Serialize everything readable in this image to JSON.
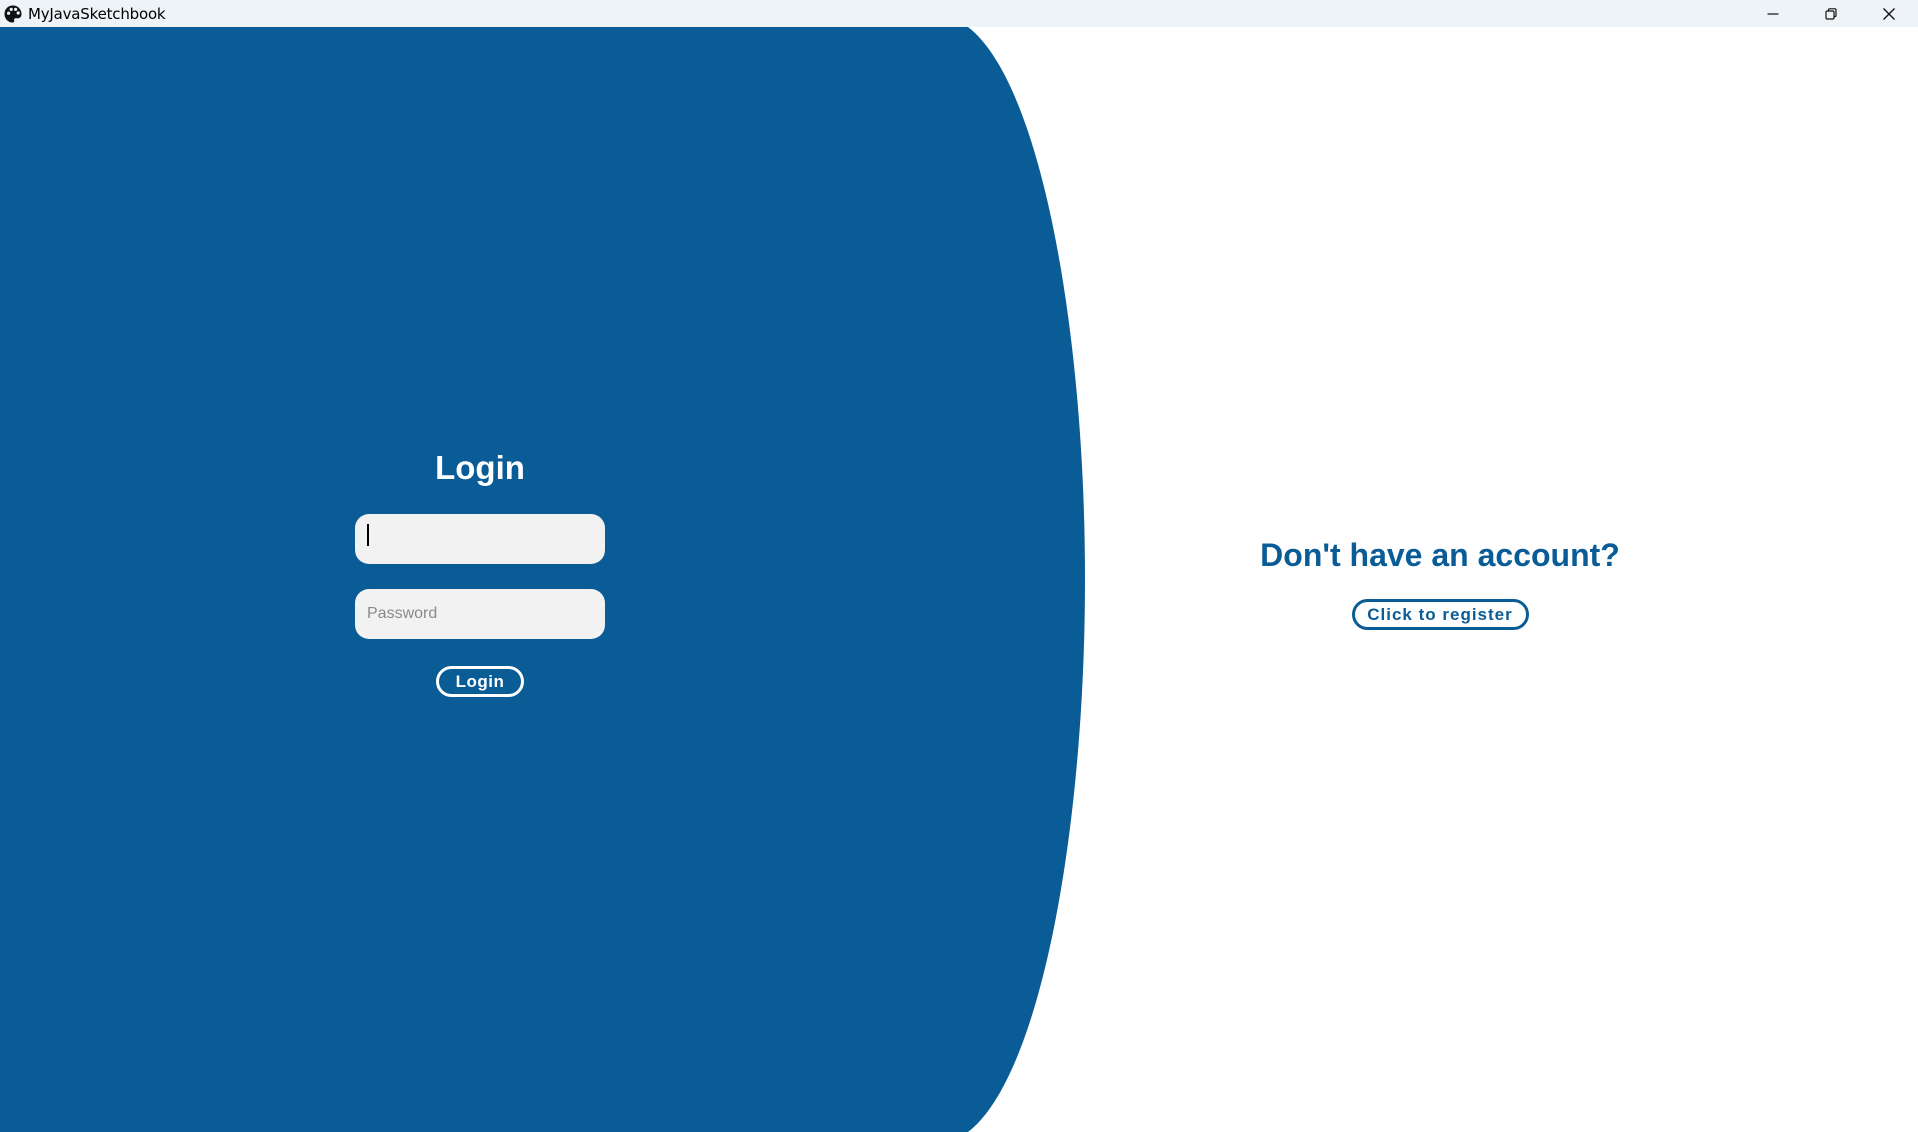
{
  "window": {
    "title": "MyJavaSketchbook",
    "icon": "palette-icon",
    "controls": [
      "minimize-icon",
      "restore-icon",
      "close-icon"
    ]
  },
  "colors": {
    "primary_blue": "#0a5c96",
    "field_bg": "#f2f2f2",
    "titlebar_bg": "#eef3f8"
  },
  "login": {
    "title": "Login",
    "username_value": "",
    "username_placeholder": "",
    "password_value": "",
    "password_placeholder": "Password",
    "button_label": "Login"
  },
  "register": {
    "title": "Don't have an account?",
    "button_label": "Click to register"
  }
}
